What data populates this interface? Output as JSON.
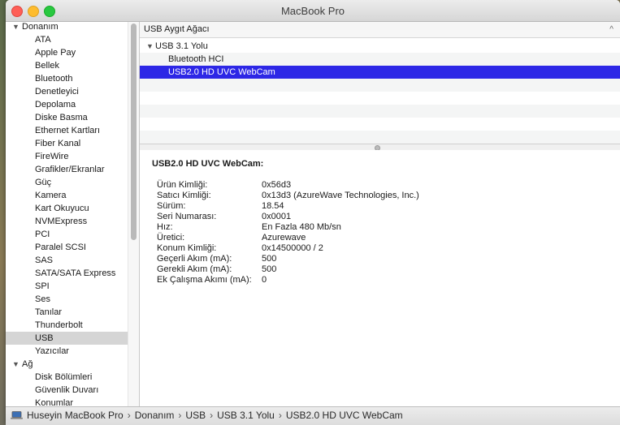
{
  "window": {
    "title": "MacBook Pro"
  },
  "sidebar": {
    "groups": [
      {
        "label": "Donanım",
        "items": [
          "ATA",
          "Apple Pay",
          "Bellek",
          "Bluetooth",
          "Denetleyici",
          "Depolama",
          "Diske Basma",
          "Ethernet Kartları",
          "Fiber Kanal",
          "FireWire",
          "Grafikler/Ekranlar",
          "Güç",
          "Kamera",
          "Kart Okuyucu",
          "NVMExpress",
          "PCI",
          "Paralel SCSI",
          "SAS",
          "SATA/SATA Express",
          "SPI",
          "Ses",
          "Tanılar",
          "Thunderbolt",
          "USB",
          "Yazıcılar"
        ]
      },
      {
        "label": "Ağ",
        "items": [
          "Disk Bölümleri",
          "Güvenlik Duvarı",
          "Konumlar"
        ]
      }
    ],
    "selected": "USB"
  },
  "tree": {
    "header": "USB Aygıt Ağacı",
    "rows": [
      {
        "label": "USB 3.1 Yolu",
        "level": 0,
        "expandable": true
      },
      {
        "label": "Bluetooth HCI",
        "level": 1
      },
      {
        "label": "USB2.0 HD UVC WebCam",
        "level": 1,
        "selected": true
      }
    ]
  },
  "detail": {
    "title": "USB2.0 HD UVC WebCam:",
    "properties": [
      {
        "key": "Ürün Kimliği:",
        "value": "0x56d3"
      },
      {
        "key": "Satıcı Kimliği:",
        "value": "0x13d3  (AzureWave Technologies, Inc.)"
      },
      {
        "key": "Sürüm:",
        "value": "18.54"
      },
      {
        "key": "Seri Numarası:",
        "value": "0x0001"
      },
      {
        "key": "Hız:",
        "value": "En Fazla 480 Mb/sn"
      },
      {
        "key": "Üretici:",
        "value": "Azurewave"
      },
      {
        "key": "Konum Kimliği:",
        "value": "0x14500000 / 2"
      },
      {
        "key": "Geçerli Akım (mA):",
        "value": "500"
      },
      {
        "key": "Gerekli Akım (mA):",
        "value": "500"
      },
      {
        "key": "Ek Çalışma Akımı (mA):",
        "value": "0"
      }
    ]
  },
  "pathbar": {
    "icon": "laptop-icon",
    "crumbs": [
      "Huseyin MacBook Pro",
      "Donanım",
      "USB",
      "USB 3.1 Yolu",
      "USB2.0 HD UVC WebCam"
    ],
    "separator": "›"
  },
  "colors": {
    "selection": "#2d27e6",
    "sidebar_selection": "#d5d5d5"
  }
}
